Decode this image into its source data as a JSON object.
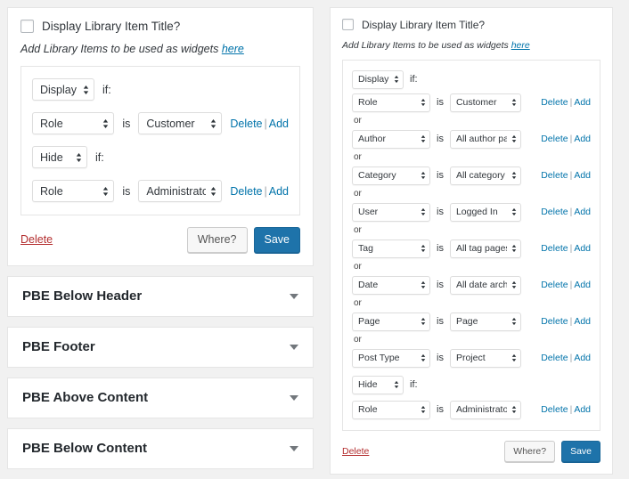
{
  "colors": {
    "page_background": "#f1f1f1",
    "card_background": "#ffffff",
    "link_blue": "#0073aa",
    "primary_button": "#1e73aa",
    "delete_red": "#b32d2e",
    "border": "#e5e5e5"
  },
  "left_widget": {
    "title_checkbox": {
      "label": "Display Library Item Title?",
      "checked": false
    },
    "hint": {
      "text_before": "Add Library Items to be used as widgets ",
      "link_text": "here"
    },
    "rules": [
      {
        "kind": "mode",
        "mode": "Display",
        "suffix": "if:"
      },
      {
        "kind": "condition",
        "left": "Role",
        "operator": "is",
        "right": "Customer",
        "delete_label": "Delete",
        "add_label": "Add"
      },
      {
        "kind": "mode",
        "mode": "Hide",
        "suffix": "if:"
      },
      {
        "kind": "condition",
        "left": "Role",
        "operator": "is",
        "right": "Administrator",
        "delete_label": "Delete",
        "add_label": "Add"
      }
    ],
    "footer": {
      "delete_label": "Delete",
      "where_label": "Where?",
      "save_label": "Save"
    }
  },
  "right_widget": {
    "title_checkbox": {
      "label": "Display Library Item Title?",
      "checked": false
    },
    "hint": {
      "text_before": "Add Library Items to be used as widgets ",
      "link_text": "here"
    },
    "rules": [
      {
        "kind": "mode",
        "mode": "Display",
        "suffix": "if:"
      },
      {
        "kind": "condition",
        "left": "Role",
        "operator": "is",
        "right": "Customer",
        "delete_label": "Delete",
        "add_label": "Add",
        "separator": "or"
      },
      {
        "kind": "condition",
        "left": "Author",
        "operator": "is",
        "right": "All author pages",
        "delete_label": "Delete",
        "add_label": "Add",
        "separator": "or"
      },
      {
        "kind": "condition",
        "left": "Category",
        "operator": "is",
        "right": "All category pages",
        "delete_label": "Delete",
        "add_label": "Add",
        "separator": "or"
      },
      {
        "kind": "condition",
        "left": "User",
        "operator": "is",
        "right": "Logged In",
        "delete_label": "Delete",
        "add_label": "Add",
        "separator": "or"
      },
      {
        "kind": "condition",
        "left": "Tag",
        "operator": "is",
        "right": "All tag pages",
        "delete_label": "Delete",
        "add_label": "Add",
        "separator": "or"
      },
      {
        "kind": "condition",
        "left": "Date",
        "operator": "is",
        "right": "All date archives",
        "delete_label": "Delete",
        "add_label": "Add",
        "separator": "or"
      },
      {
        "kind": "condition",
        "left": "Page",
        "operator": "is",
        "right": "Page",
        "delete_label": "Delete",
        "add_label": "Add",
        "separator": "or"
      },
      {
        "kind": "condition",
        "left": "Post Type",
        "operator": "is",
        "right": "Project",
        "delete_label": "Delete",
        "add_label": "Add",
        "separator": ""
      },
      {
        "kind": "mode",
        "mode": "Hide",
        "suffix": "if:"
      },
      {
        "kind": "condition",
        "left": "Role",
        "operator": "is",
        "right": "Administrator",
        "delete_label": "Delete",
        "add_label": "Add",
        "separator": ""
      }
    ],
    "footer": {
      "delete_label": "Delete",
      "where_label": "Where?",
      "save_label": "Save"
    }
  },
  "accordions": [
    {
      "title": "PBE Below Header",
      "expanded": false
    },
    {
      "title": "PBE Footer",
      "expanded": false
    },
    {
      "title": "PBE Above Content",
      "expanded": false
    },
    {
      "title": "PBE Below Content",
      "expanded": false
    }
  ]
}
